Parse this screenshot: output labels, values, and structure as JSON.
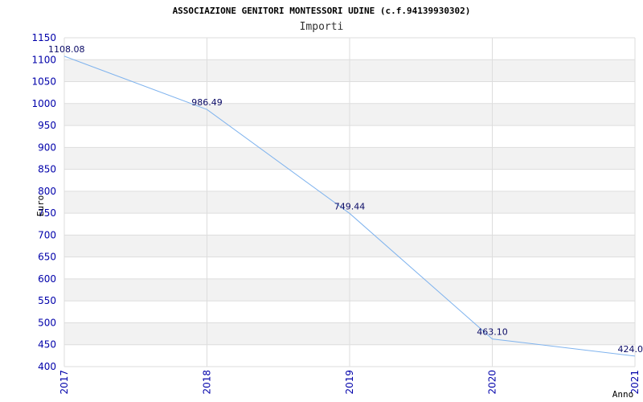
{
  "chart_data": {
    "type": "line",
    "title": "ASSOCIAZIONE GENITORI MONTESSORI UDINE (c.f.94139930302)",
    "subtitle": "Importi",
    "xlabel": "Anno",
    "ylabel": "Euro",
    "ylim": [
      400,
      1150
    ],
    "yticks": [
      "400",
      "450",
      "500",
      "550",
      "600",
      "650",
      "700",
      "750",
      "800",
      "850",
      "900",
      "950",
      "1000",
      "1050",
      "1100",
      "1150"
    ],
    "categories": [
      "2017",
      "2018",
      "2019",
      "2020",
      "2021"
    ],
    "values": [
      1108.08,
      986.49,
      749.44,
      463.1,
      424.0
    ],
    "data_labels": [
      "1108.08",
      "986.49",
      "749.44",
      "463.10",
      "424.0"
    ],
    "grid": true,
    "colors": {
      "line": "#7fb3ee",
      "band": "#f2f2f2",
      "tick_text": "#0000aa",
      "label_text": "#0a0a66"
    }
  }
}
